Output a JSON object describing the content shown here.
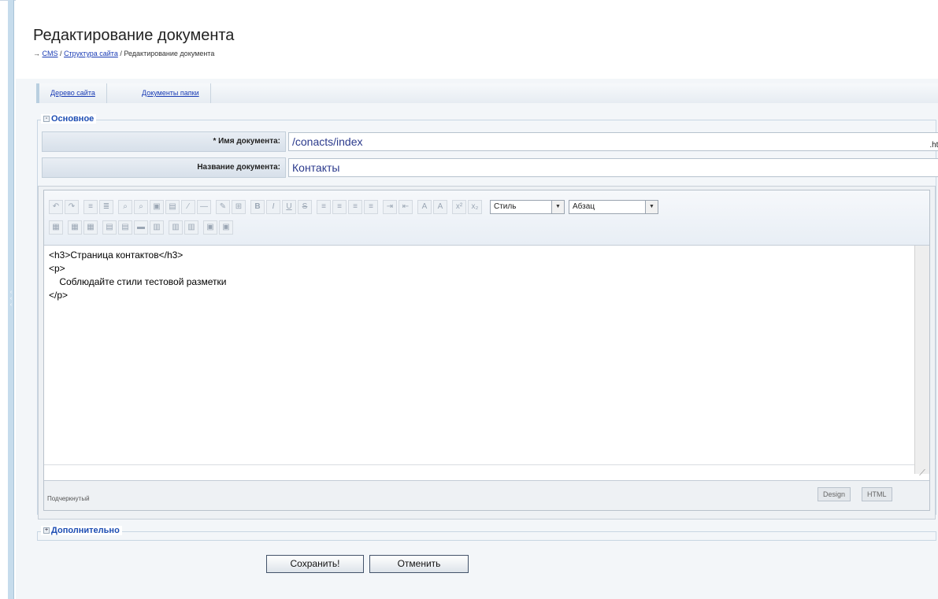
{
  "page": {
    "title": "Редактирование документа",
    "breadcrumb": {
      "arrow": "→",
      "items": [
        "CMS",
        "Структура сайта",
        "Редактирование документа"
      ],
      "separator": "/"
    }
  },
  "tabs": [
    {
      "label": "Дерево сайта"
    },
    {
      "label": "Документы папки"
    }
  ],
  "main_section": {
    "legend": "Основное",
    "fields": {
      "doc_name": {
        "label": "* Имя документа:",
        "value": "/conacts/index",
        "suffix": ".html"
      },
      "doc_title": {
        "label": "Название документа:",
        "value": "Контакты"
      }
    }
  },
  "editor": {
    "toolbar": {
      "icons": [
        "undo-icon",
        "redo-icon",
        "ordered-list-icon",
        "unordered-list-icon",
        "find-icon",
        "replace-icon",
        "image-icon",
        "media-icon",
        "link-icon",
        "horizontal-rule-icon",
        "edit-source-icon",
        "table-icon",
        "bold-icon",
        "italic-icon",
        "underline-icon",
        "strikethrough-icon",
        "align-left-icon",
        "align-center-icon",
        "align-right-icon",
        "align-justify-icon",
        "indent-icon",
        "outdent-icon",
        "text-color-icon",
        "background-color-icon",
        "superscript-icon",
        "subscript-icon"
      ],
      "style_select": "Стиль",
      "format_select": "Абзац"
    },
    "content": "<h3>Страница контактов</h3>\n<p>\n    Соблюдайте стили тестовой разметки\n</p>",
    "status_text": "Подчеркнутый",
    "modes": {
      "design": "Design",
      "html": "HTML"
    }
  },
  "extra_section": {
    "legend": "Дополнительно"
  },
  "actions": {
    "save": "Сохранить!",
    "cancel": "Отменить"
  },
  "colors": {
    "link": "#1a3cb5",
    "legend": "#1d4db3",
    "rail": "#c6dcec"
  }
}
